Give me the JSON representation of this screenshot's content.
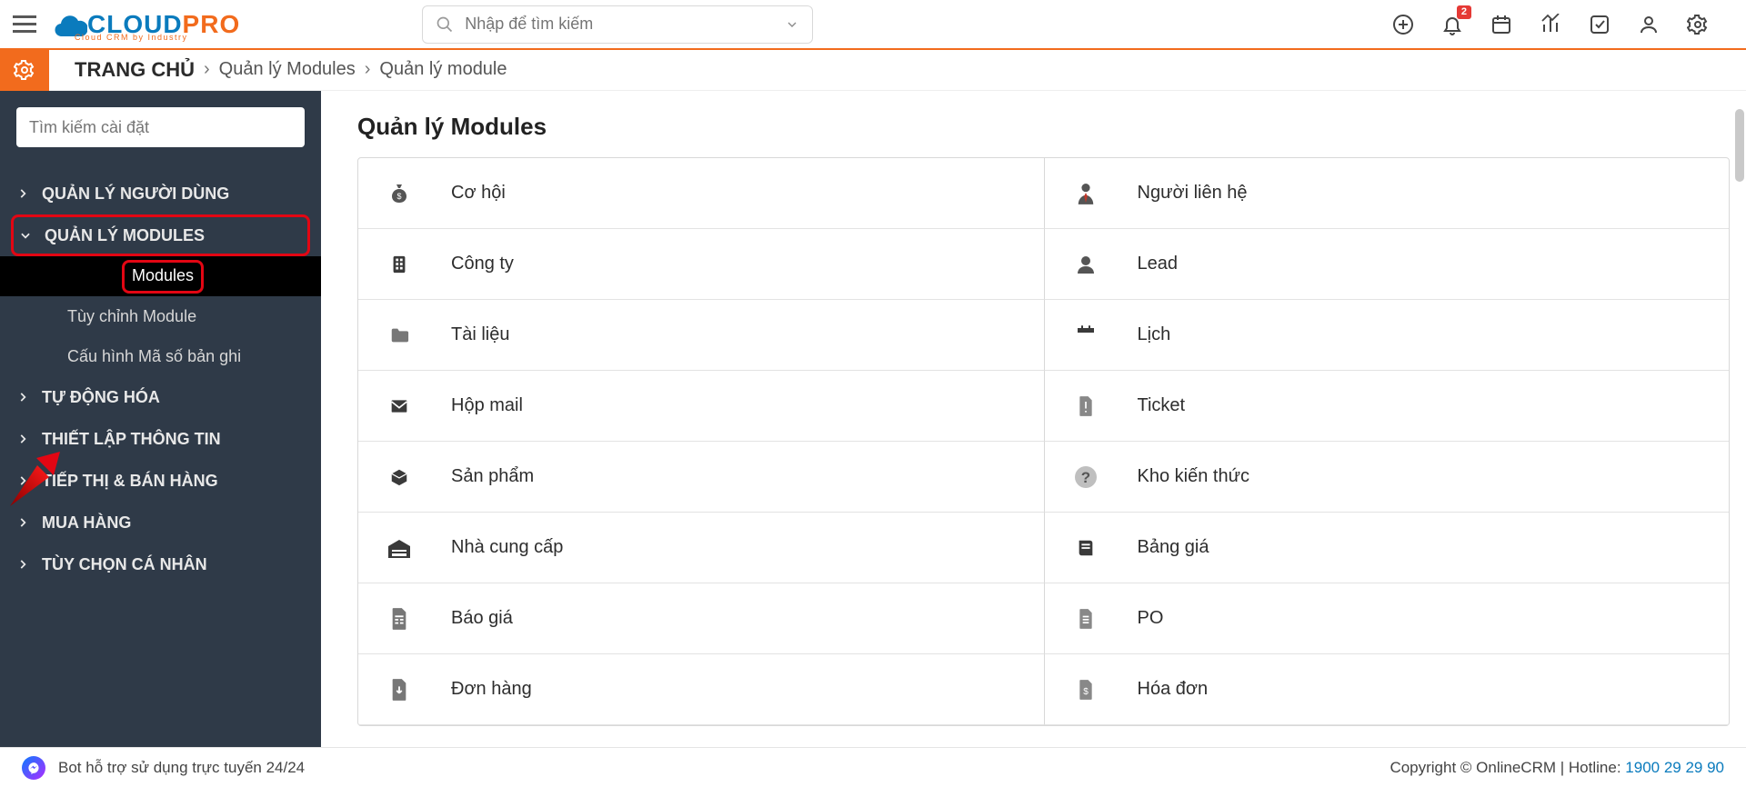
{
  "brand": {
    "part1": "CLOUD",
    "part2": "PRO",
    "tagline": "Cloud CRM by Industry"
  },
  "search": {
    "placeholder": "Nhập để tìm kiếm"
  },
  "notifications": {
    "count": "2"
  },
  "breadcrumb": {
    "home": "TRANG CHỦ",
    "a": "Quản lý Modules",
    "b": "Quản lý module"
  },
  "sidebar": {
    "search_placeholder": "Tìm kiếm cài đặt",
    "items": [
      {
        "label": "QUẢN LÝ NGƯỜI DÙNG",
        "expanded": false
      },
      {
        "label": "QUẢN LÝ MODULES",
        "expanded": true,
        "children": [
          {
            "label": "Modules",
            "active": true
          },
          {
            "label": "Tùy chỉnh Module"
          },
          {
            "label": "Cấu hình Mã số bản ghi"
          }
        ]
      },
      {
        "label": "TỰ ĐỘNG HÓA"
      },
      {
        "label": "THIẾT LẬP THÔNG TIN"
      },
      {
        "label": "TIẾP THỊ & BÁN HÀNG"
      },
      {
        "label": "MUA HÀNG"
      },
      {
        "label": "TÙY CHỌN CÁ NHÂN"
      }
    ]
  },
  "page": {
    "title": "Quản lý Modules"
  },
  "modules": {
    "left": [
      "Cơ hội",
      "Công ty",
      "Tài liệu",
      "Hộp mail",
      "Sản phẩm",
      "Nhà cung cấp",
      "Báo giá",
      "Đơn hàng"
    ],
    "right": [
      "Người liên hệ",
      "Lead",
      "Lịch",
      "Ticket",
      "Kho kiến thức",
      "Bảng giá",
      "PO",
      "Hóa đơn"
    ]
  },
  "footer": {
    "bot": "Bot hỗ trợ sử dụng trực tuyến 24/24",
    "copyright": "Copyright © OnlineCRM",
    "hotline_label": "Hotline:",
    "hotline": "1900 29 29 90"
  },
  "icons": {
    "module_left": [
      "moneybag",
      "building",
      "folder",
      "mail",
      "box",
      "warehouse",
      "doc-calc",
      "doc-arrow"
    ],
    "module_right": [
      "person-tie",
      "user",
      "calendar",
      "alert-doc",
      "question",
      "book",
      "doc",
      "doc-dollar"
    ]
  }
}
